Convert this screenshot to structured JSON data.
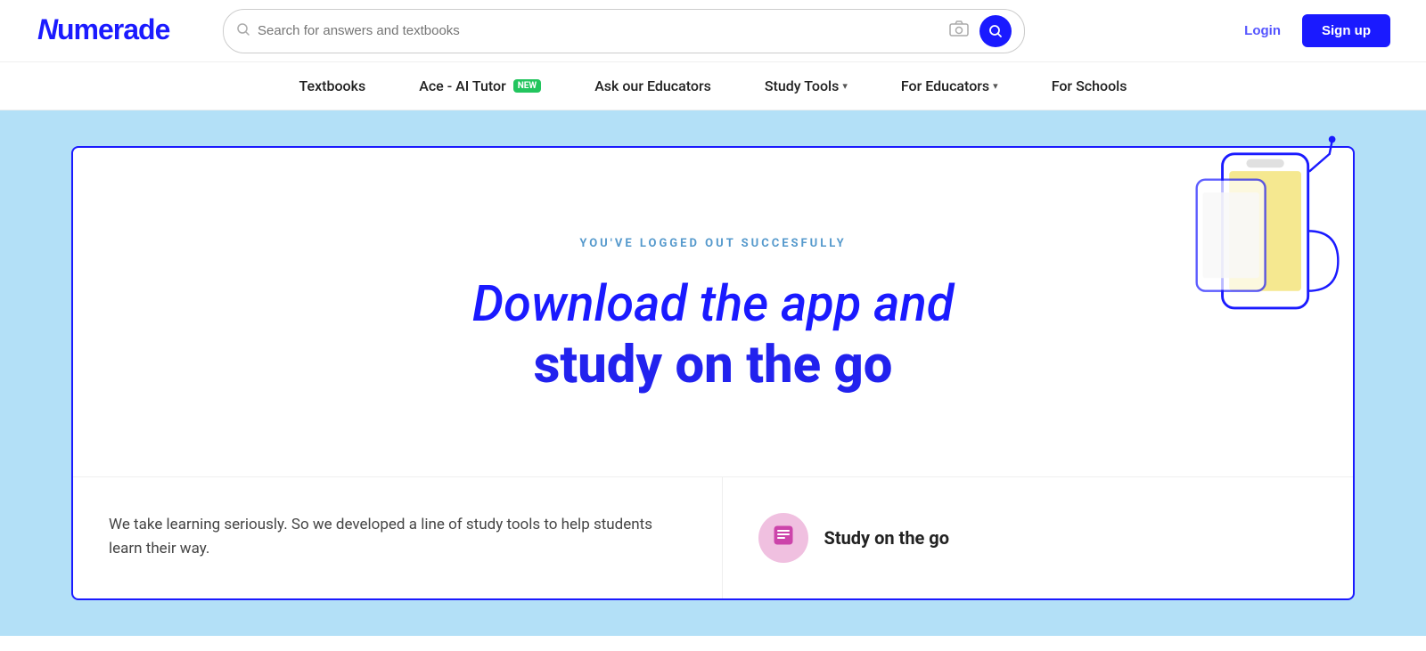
{
  "header": {
    "logo_text": "Numerade",
    "search_placeholder": "Search for answers and textbooks",
    "login_label": "Login",
    "signup_label": "Sign up"
  },
  "nav": {
    "items": [
      {
        "label": "Textbooks",
        "has_dropdown": false,
        "has_new": false
      },
      {
        "label": "Ace - AI Tutor",
        "has_dropdown": false,
        "has_new": true,
        "new_label": "NEW"
      },
      {
        "label": "Ask our Educators",
        "has_dropdown": false,
        "has_new": false
      },
      {
        "label": "Study Tools",
        "has_dropdown": true,
        "has_new": false
      },
      {
        "label": "For Educators",
        "has_dropdown": true,
        "has_new": false
      },
      {
        "label": "For Schools",
        "has_dropdown": false,
        "has_new": false
      }
    ]
  },
  "hero": {
    "logout_message": "YOU'VE LOGGED OUT SUCCESFULLY",
    "heading_line1": "Download the app and",
    "heading_line2": "study on the go",
    "description": "We take learning seriously. So we developed a line of study tools to help students learn their way.",
    "study_on_go_label": "Study on the go"
  }
}
